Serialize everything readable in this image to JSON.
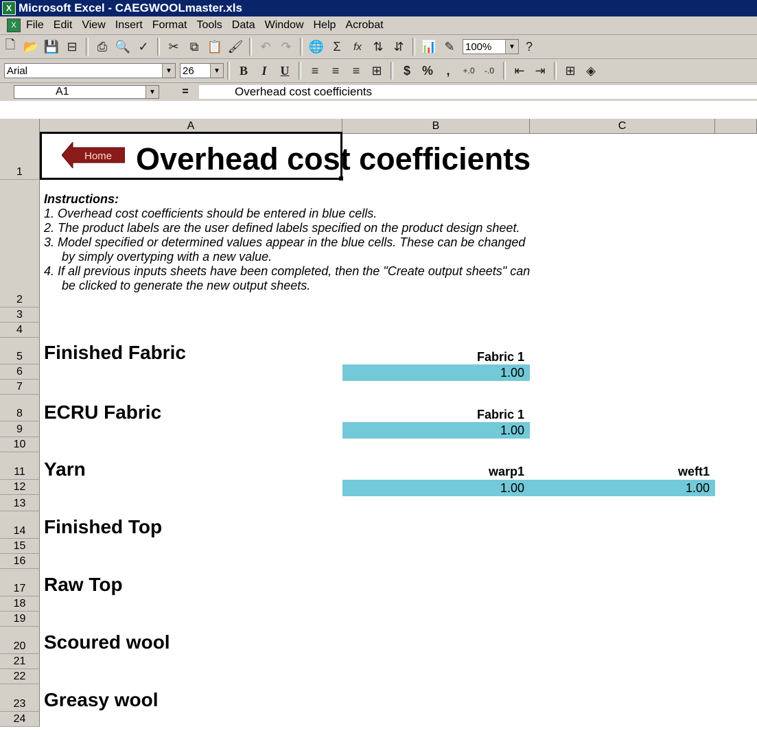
{
  "window": {
    "title": "Microsoft Excel - CAEGWOOLmaster.xls",
    "app_icon": "excel-icon"
  },
  "menu": [
    "File",
    "Edit",
    "View",
    "Insert",
    "Format",
    "Tools",
    "Data",
    "Window",
    "Help",
    "Acrobat"
  ],
  "toolbar": {
    "zoom": "100%",
    "font": "Arial",
    "font_size": "26",
    "sigma": "Σ",
    "fx": "fx",
    "currency": "$",
    "percent": "%",
    "comma": ","
  },
  "formula_bar": {
    "cell_ref": "A1",
    "equals": "=",
    "content": "Overhead cost coefficients"
  },
  "columns": [
    "A",
    "B",
    "C"
  ],
  "rows": [
    "1",
    "2",
    "3",
    "4",
    "5",
    "6",
    "7",
    "8",
    "9",
    "10",
    "11",
    "12",
    "13",
    "14",
    "15",
    "16",
    "17",
    "18",
    "19",
    "20",
    "21",
    "22",
    "23",
    "24"
  ],
  "sheet": {
    "home_button": "Home",
    "title": "Overhead cost coefficients",
    "instructions": {
      "heading": "Instructions:",
      "lines": [
        "1. Overhead cost coefficients should be entered in blue cells.",
        "2. The product labels are the user defined labels specified on the product design sheet.",
        "3. Model specified or determined values appear in the blue cells. These can be changed",
        "   by simply overtyping with a new value.",
        "4. If all previous inputs sheets have been completed, then the \"Create output sheets\" can",
        "   be clicked to generate the new output sheets."
      ]
    },
    "sections": [
      {
        "name": "Finished Fabric",
        "labels": [
          "Fabric 1"
        ],
        "values": [
          "1.00"
        ]
      },
      {
        "name": "ECRU Fabric",
        "labels": [
          "Fabric 1"
        ],
        "values": [
          "1.00"
        ]
      },
      {
        "name": "Yarn",
        "labels": [
          "warp1",
          "weft1"
        ],
        "values": [
          "1.00",
          "1.00"
        ]
      },
      {
        "name": "Finished Top"
      },
      {
        "name": "Raw Top"
      },
      {
        "name": "Scoured wool"
      },
      {
        "name": "Greasy wool"
      }
    ]
  },
  "colors": {
    "input_cell": "#73c9d8",
    "home_arrow": "#8b1a1a",
    "titlebar": "#0a246a"
  }
}
